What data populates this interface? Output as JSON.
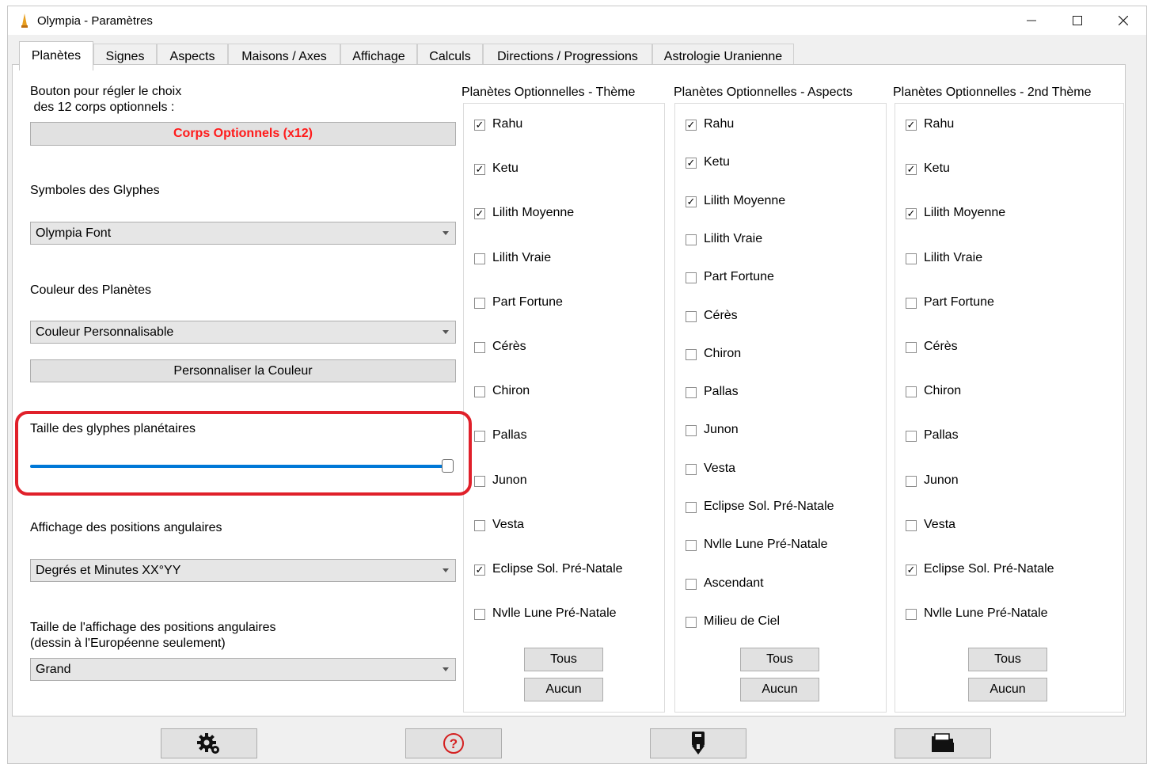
{
  "window": {
    "title": "Olympia - Paramètres",
    "controls": {
      "minimize": "—",
      "maximize": "☐",
      "close": "✕"
    }
  },
  "tabs": [
    {
      "label": "Planètes",
      "active": true
    },
    {
      "label": "Signes"
    },
    {
      "label": "Aspects"
    },
    {
      "label": "Maisons / Axes"
    },
    {
      "label": "Affichage"
    },
    {
      "label": "Calculs"
    },
    {
      "label": "Directions / Progressions"
    },
    {
      "label": "Astrologie Uranienne"
    }
  ],
  "left": {
    "optional_bodies_line1": "Bouton pour régler le choix",
    "optional_bodies_line2": " des 12 corps optionnels :",
    "optional_bodies_button": "Corps Optionnels (x12)",
    "glyph_symbols_label": "Symboles des Glyphes",
    "glyph_symbols_value": "Olympia Font",
    "planet_color_label": "Couleur des Planètes",
    "planet_color_value": "Couleur Personnalisable",
    "customize_color_button": "Personnaliser la Couleur",
    "glyph_size_label": "Taille des glyphes planétaires",
    "glyph_size_slider_fraction": 1.0,
    "angular_display_label": "Affichage des positions angulaires",
    "angular_display_value": "Degrés et Minutes XX°YY",
    "angular_size_line1": "Taille de l'affichage des positions angulaires",
    "angular_size_line2": "(dessin à l'Européenne seulement)",
    "angular_size_value": "Grand"
  },
  "groups": {
    "theme": {
      "title": "Planètes Optionnelles - Thème",
      "items": [
        {
          "label": "Rahu",
          "checked": true
        },
        {
          "label": "Ketu",
          "checked": true
        },
        {
          "label": "Lilith Moyenne",
          "checked": true
        },
        {
          "label": "Lilith Vraie",
          "checked": false
        },
        {
          "label": "Part Fortune",
          "checked": false
        },
        {
          "label": "Cérès",
          "checked": false
        },
        {
          "label": "Chiron",
          "checked": false
        },
        {
          "label": "Pallas",
          "checked": false
        },
        {
          "label": "Junon",
          "checked": false
        },
        {
          "label": "Vesta",
          "checked": false
        },
        {
          "label": "Eclipse Sol. Pré-Natale",
          "checked": true
        },
        {
          "label": "Nvlle Lune Pré-Natale",
          "checked": false
        }
      ],
      "all_button": "Tous",
      "none_button": "Aucun"
    },
    "aspects": {
      "title": "Planètes Optionnelles - Aspects",
      "items": [
        {
          "label": "Rahu",
          "checked": true
        },
        {
          "label": "Ketu",
          "checked": true
        },
        {
          "label": "Lilith Moyenne",
          "checked": true
        },
        {
          "label": "Lilith Vraie",
          "checked": false
        },
        {
          "label": "Part Fortune",
          "checked": false
        },
        {
          "label": "Cérès",
          "checked": false
        },
        {
          "label": "Chiron",
          "checked": false
        },
        {
          "label": "Pallas",
          "checked": false
        },
        {
          "label": "Junon",
          "checked": false
        },
        {
          "label": "Vesta",
          "checked": false
        },
        {
          "label": "Eclipse Sol. Pré-Natale",
          "checked": false
        },
        {
          "label": "Nvlle Lune Pré-Natale",
          "checked": false
        },
        {
          "label": "Ascendant",
          "checked": false
        },
        {
          "label": "Milieu de Ciel",
          "checked": false
        }
      ],
      "all_button": "Tous",
      "none_button": "Aucun"
    },
    "second": {
      "title": "Planètes Optionnelles - 2nd Thème",
      "items": [
        {
          "label": "Rahu",
          "checked": true
        },
        {
          "label": "Ketu",
          "checked": true
        },
        {
          "label": "Lilith Moyenne",
          "checked": true
        },
        {
          "label": "Lilith Vraie",
          "checked": false
        },
        {
          "label": "Part Fortune",
          "checked": false
        },
        {
          "label": "Cérès",
          "checked": false
        },
        {
          "label": "Chiron",
          "checked": false
        },
        {
          "label": "Pallas",
          "checked": false
        },
        {
          "label": "Junon",
          "checked": false
        },
        {
          "label": "Vesta",
          "checked": false
        },
        {
          "label": "Eclipse Sol. Pré-Natale",
          "checked": true
        },
        {
          "label": "Nvlle Lune Pré-Natale",
          "checked": false
        }
      ],
      "all_button": "Tous",
      "none_button": "Aucun"
    }
  },
  "colors": {
    "accent_red": "#ff1a1a",
    "highlight": "#e0202a",
    "slider": "#0078d7"
  },
  "bottom_bar": {
    "icons": [
      "settings-gear-icon",
      "help-question-icon",
      "save-download-icon",
      "open-folder-icon"
    ]
  }
}
